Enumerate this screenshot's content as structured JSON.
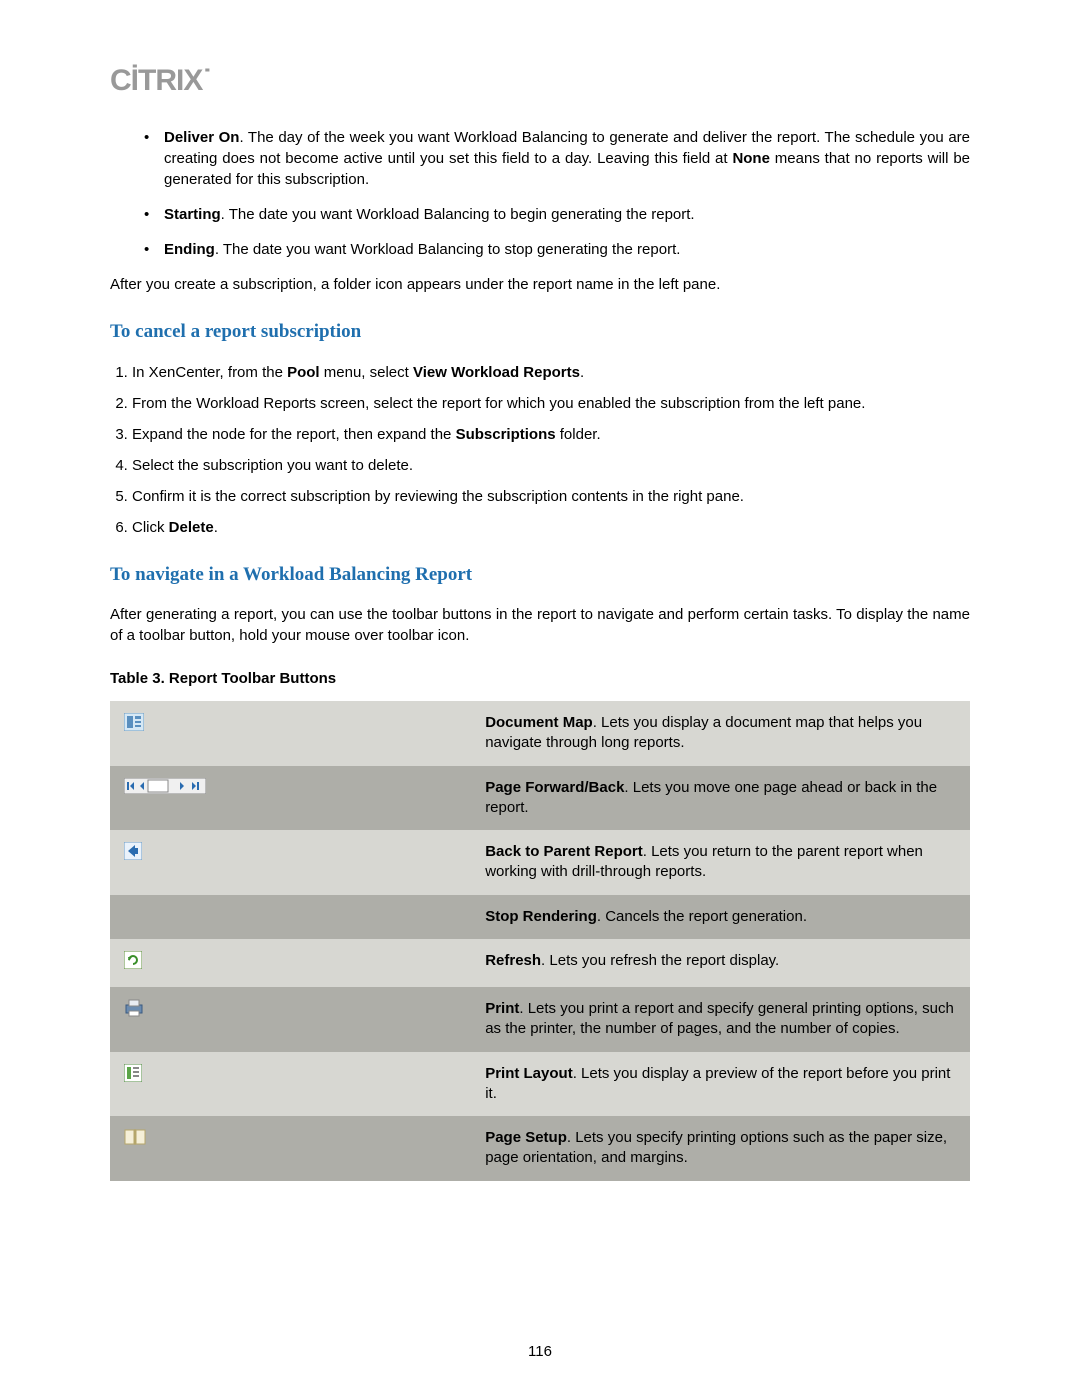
{
  "logo": "CİTRIX",
  "bullets": [
    {
      "term": "Deliver On",
      "text": ". The day of the week you want Workload Balancing to generate and deliver the report. The schedule you are creating does not become active until you set this field to a day. Leaving this field at ",
      "term2": "None",
      "text2": " means that no reports will be generated for this subscription."
    },
    {
      "term": "Starting",
      "text": ". The date you want Workload Balancing to begin generating the report."
    },
    {
      "term": "Ending",
      "text": ". The date you want Workload Balancing to stop generating the report."
    }
  ],
  "after_sub": "After you create a subscription, a folder icon appears under the report name in the left pane.",
  "h_cancel": "To cancel a report subscription",
  "cancel_steps": {
    "s1a": "In XenCenter, from the ",
    "s1b": "Pool",
    "s1c": " menu, select ",
    "s1d": "View Workload Reports",
    "s1e": ".",
    "s2": "From the Workload Reports screen, select the report for which you enabled the subscription from the left pane.",
    "s3a": "Expand the node for the report, then expand the ",
    "s3b": "Subscriptions",
    "s3c": " folder.",
    "s4": "Select the subscription you want to delete.",
    "s5": "Confirm it is the correct subscription by reviewing the subscription contents in the right pane.",
    "s6a": "Click ",
    "s6b": "Delete",
    "s6c": "."
  },
  "h_nav": "To navigate in a Workload Balancing Report",
  "nav_para": "After generating a report, you can use the toolbar buttons in the report to navigate and perform certain tasks. To display the name of a toolbar button, hold your mouse over toolbar icon.",
  "table_caption": "Table 3. Report Toolbar Buttons",
  "rows": [
    {
      "icon": "document-map-icon",
      "term": "Document Map",
      "text": ". Lets you display a document map that helps you navigate through long reports."
    },
    {
      "icon": "page-nav-icon",
      "term": "Page Forward/Back",
      "text": ". Lets you move one page ahead or back in the report."
    },
    {
      "icon": "back-parent-icon",
      "term": "Back to Parent Report",
      "text": ". Lets you return to the parent report when working with drill-through reports."
    },
    {
      "icon": "stop-rendering-icon",
      "term": "Stop Rendering",
      "text": ". Cancels the report generation."
    },
    {
      "icon": "refresh-icon",
      "term": "Refresh",
      "text": ". Lets you refresh the report display."
    },
    {
      "icon": "print-icon",
      "term": "Print",
      "text": ". Lets you print a report and specify general printing options, such as the printer, the number of pages, and the number of copies."
    },
    {
      "icon": "print-layout-icon",
      "term": "Print Layout",
      "text": ". Lets you display a preview of the report before you print it."
    },
    {
      "icon": "page-setup-icon",
      "term": "Page Setup",
      "text": ". Lets you specify printing options such as the paper size, page orientation, and margins."
    }
  ],
  "page_number": "116"
}
